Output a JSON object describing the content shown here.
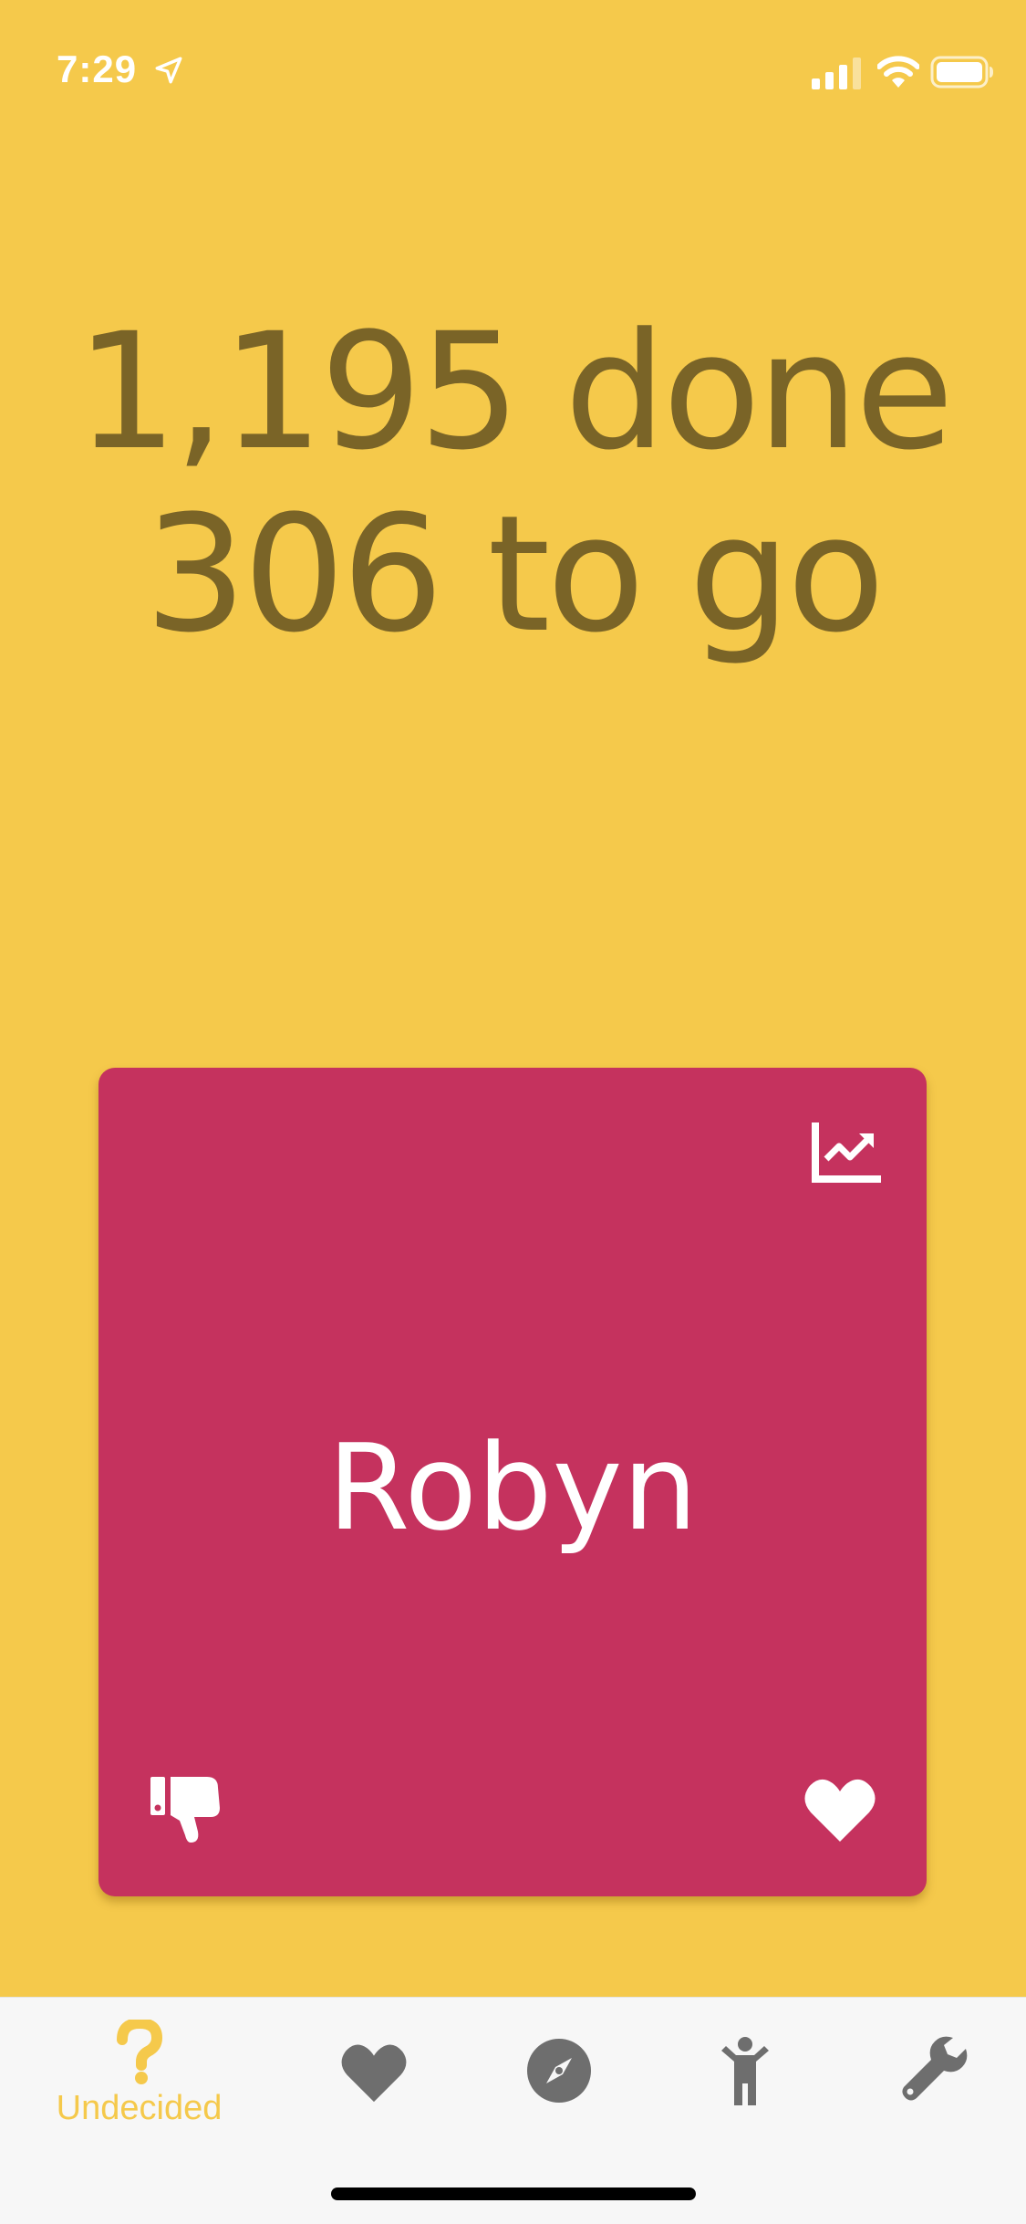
{
  "status_bar": {
    "time": "7:29"
  },
  "progress": {
    "done_text": "1,195 done",
    "to_go_text": "306 to go"
  },
  "card": {
    "name": "Robyn",
    "background_color": "#C5325E"
  },
  "tab_bar": {
    "tabs": [
      {
        "label": "Undecided",
        "icon": "question-mark-icon",
        "active": true
      },
      {
        "label": "",
        "icon": "heart-icon",
        "active": false
      },
      {
        "label": "",
        "icon": "compass-icon",
        "active": false
      },
      {
        "label": "",
        "icon": "child-icon",
        "active": false
      },
      {
        "label": "",
        "icon": "wrench-icon",
        "active": false
      }
    ],
    "active_color": "#F5C94B",
    "inactive_color": "#6E6E6E"
  },
  "colors": {
    "background": "#F5C94B",
    "progress_text": "#7A6427"
  }
}
